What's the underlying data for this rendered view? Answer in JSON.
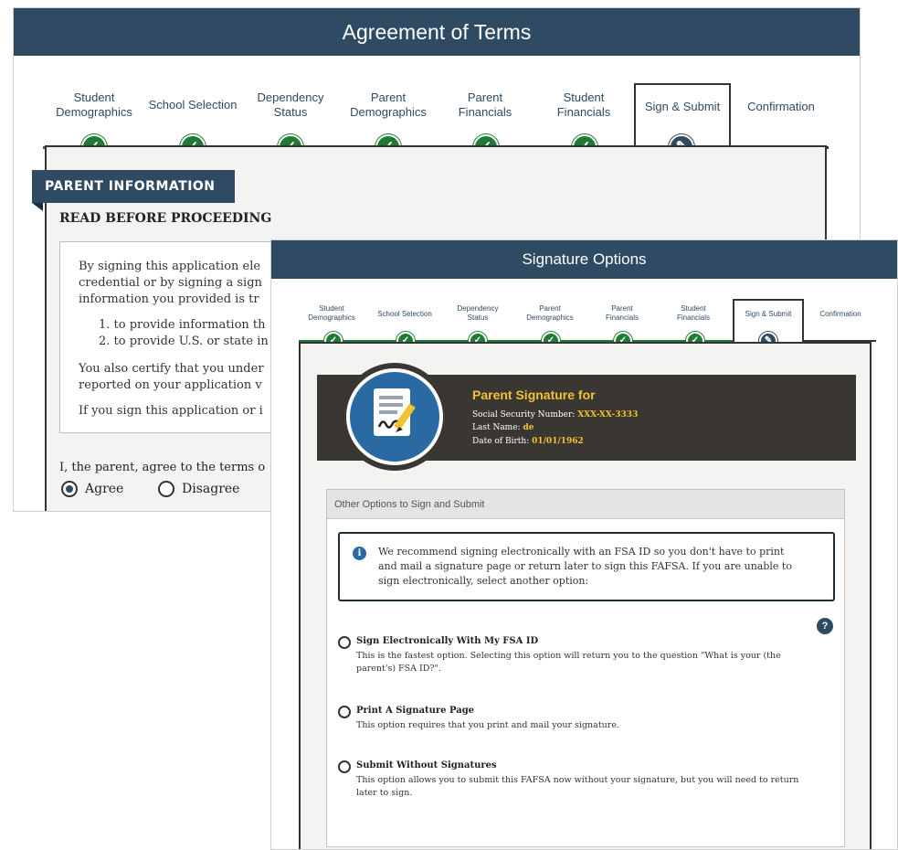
{
  "back_window": {
    "title": "Agreement of Terms",
    "steps": [
      {
        "label": "Student\nDemographics",
        "state": "done"
      },
      {
        "label": "School Selection",
        "state": "done"
      },
      {
        "label": "Dependency\nStatus",
        "state": "done"
      },
      {
        "label": "Parent\nDemographics",
        "state": "done"
      },
      {
        "label": "Parent\nFinancials",
        "state": "done"
      },
      {
        "label": "Student\nFinancials",
        "state": "done"
      },
      {
        "label": "Sign & Submit",
        "state": "current"
      },
      {
        "label": "Confirmation",
        "state": "todo"
      }
    ],
    "section_banner": "PARENT INFORMATION",
    "read_heading": "READ BEFORE PROCEEDING",
    "terms": {
      "para1": "By signing this application ele",
      "para1_line2": "credential or by signing a sign",
      "para1_line3": "information you provided is tr",
      "list": [
        "1. to provide information th",
        "2. to provide U.S. or state in"
      ],
      "para2": "You also certify that you under",
      "para2_line2": "reported on your application v",
      "para3": "If you sign this application or i"
    },
    "agree_prompt": "I, the parent, agree to the terms o",
    "agree_label": "Agree",
    "disagree_label": "Disagree"
  },
  "front_window": {
    "title": "Signature Options",
    "steps": [
      {
        "label": "Student\nDemographics",
        "state": "done"
      },
      {
        "label": "School Selection",
        "state": "done"
      },
      {
        "label": "Dependency\nStatus",
        "state": "done"
      },
      {
        "label": "Parent\nDemographics",
        "state": "done"
      },
      {
        "label": "Parent\nFinancials",
        "state": "done"
      },
      {
        "label": "Student\nFinancials",
        "state": "done"
      },
      {
        "label": "Sign & Submit",
        "state": "current"
      },
      {
        "label": "Confirmation",
        "state": "todo"
      }
    ],
    "signature": {
      "title": "Parent Signature for",
      "ssn_label": "Social Security Number:",
      "ssn_value": "XXX-XX-3333",
      "last_name_label": "Last Name:",
      "last_name_value": "de",
      "dob_label": "Date of Birth:",
      "dob_value": "01/01/1962"
    },
    "options_panel": {
      "header": "Other Options to Sign and Submit",
      "info_line1": "We recommend signing electronically with an FSA ID so you don't have to print",
      "info_line2": "and mail a signature page or return later to sign this FAFSA. If you are unable to",
      "info_line3": "sign electronically, select another option:",
      "options": [
        {
          "title": "Sign Electronically With My FSA ID",
          "desc": "This is the fastest option. Selecting this option will return you to the question \"What is your (the parent's) FSA ID?\"."
        },
        {
          "title": "Print A Signature Page",
          "desc": "This option requires that you print and mail your signature."
        },
        {
          "title": "Submit Without Signatures",
          "desc": "This option allows you to submit this FAFSA now without your signature, but you will need to return later to sign."
        }
      ]
    }
  },
  "icons": {
    "check": "check-icon",
    "edit": "pencil-icon",
    "info": "info-icon",
    "help": "question-icon",
    "signature": "signature-document-icon"
  },
  "colors": {
    "header_navy": "#2f4a63",
    "step_green": "#1f7a33",
    "sig_banner": "#3a3733",
    "sig_gold": "#f2c230",
    "icon_blue": "#2a6aa3"
  }
}
